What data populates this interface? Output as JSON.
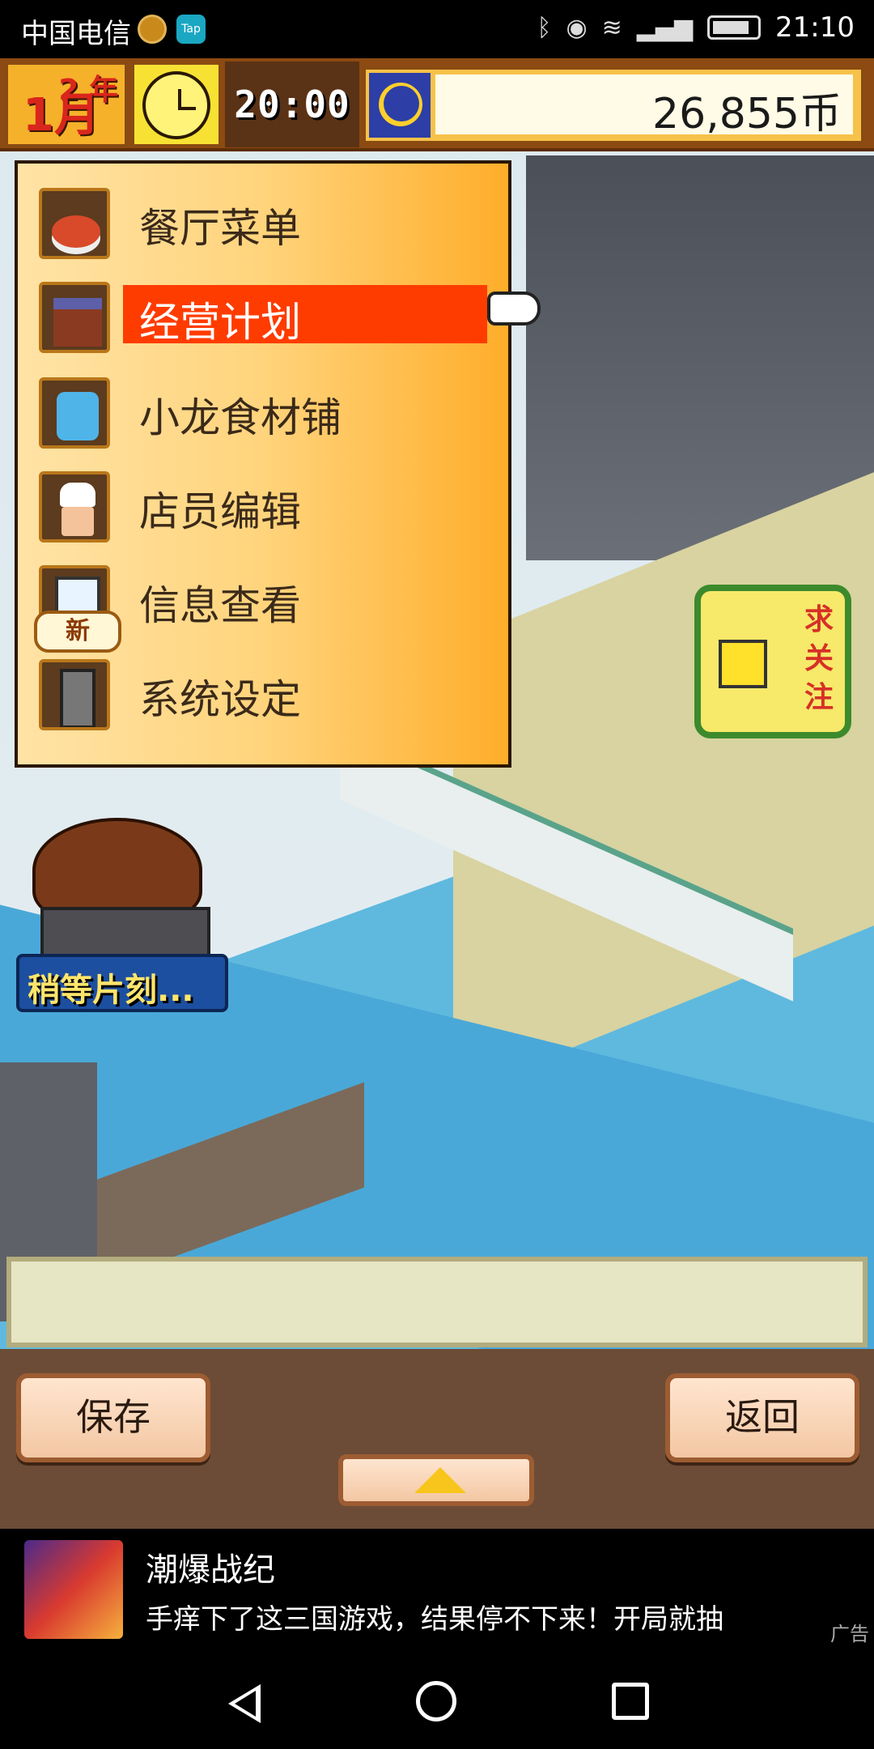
{
  "status_bar": {
    "carrier": "中国电信",
    "tap_label": "Tap",
    "time": "21:10"
  },
  "hud": {
    "year_label": "2 年",
    "month_label": "1月",
    "game_time": "20:00",
    "money": "26,855币"
  },
  "menu": {
    "items": [
      {
        "label": "餐厅菜单",
        "icon": "dish-icon"
      },
      {
        "label": "经营计划",
        "icon": "shop-icon",
        "selected": true
      },
      {
        "label": "小龙食材铺",
        "icon": "dragon-icon"
      },
      {
        "label": "店员编辑",
        "icon": "chef-icon"
      },
      {
        "label": "信息查看",
        "icon": "info-icon",
        "badge": "新"
      },
      {
        "label": "系统设定",
        "icon": "phone-icon"
      }
    ]
  },
  "follow_badge": {
    "text": "求关注"
  },
  "event_badge": {
    "label": "稍等片刻..."
  },
  "buttons": {
    "save": "保存",
    "back": "返回"
  },
  "ad": {
    "title": "潮爆战纪",
    "description": "手痒下了这三国游戏，结果停不下来！开局就抽",
    "tag": "广告"
  },
  "colors": {
    "menu_highlight": "#ff3c00",
    "hud_brown": "#8d4a12",
    "money_panel": "#f7c24a"
  }
}
